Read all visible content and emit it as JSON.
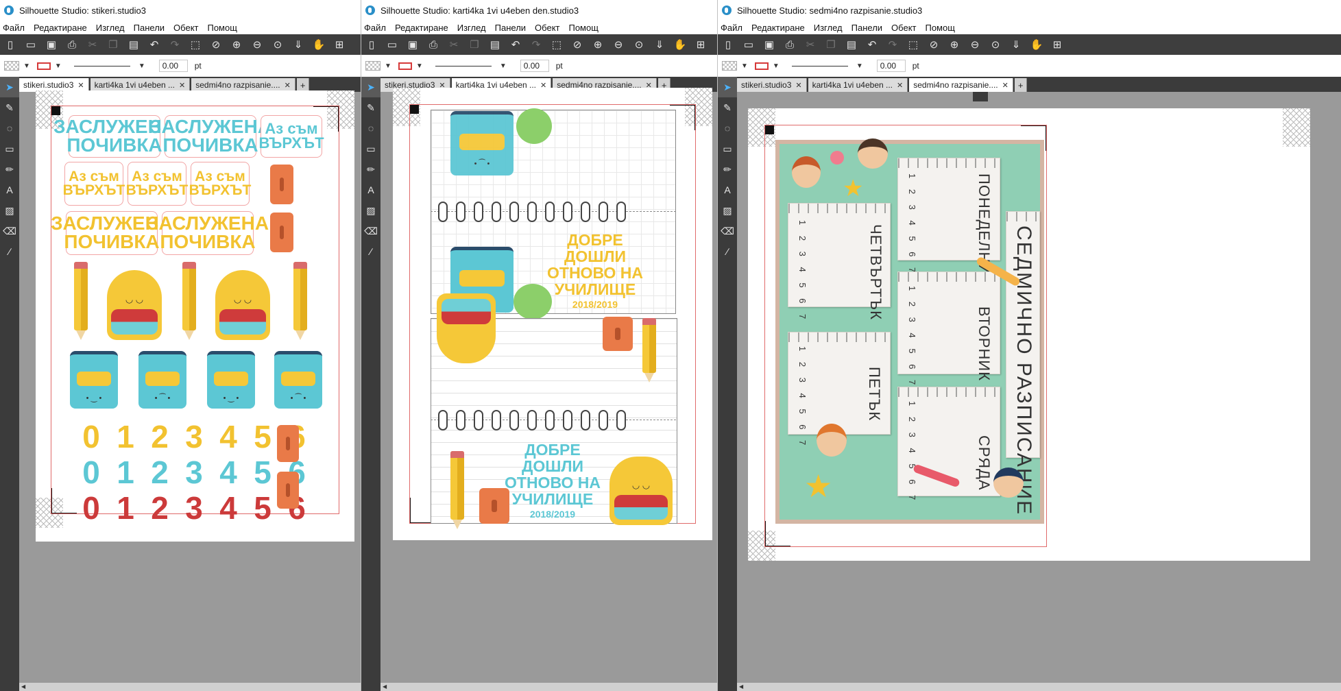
{
  "menu": [
    "Файл",
    "Редактиране",
    "Изглед",
    "Панели",
    "Обект",
    "Помощ"
  ],
  "stroke_width": "0.00",
  "stroke_unit": "pt",
  "tabs": [
    "stikeri.studio3",
    "karti4ka 1vi u4eben ...",
    "sedmi4no razpisanie...."
  ],
  "windows": [
    {
      "title": "Silhouette Studio: stikeri.studio3",
      "active_tab": 0
    },
    {
      "title": "Silhouette Studio: karti4ka 1vi u4eben den.studio3",
      "active_tab": 1
    },
    {
      "title": "Silhouette Studio: sedmi4no razpisanie.studio3",
      "active_tab": 2
    }
  ],
  "stickers": {
    "zasluzhena": "ЗАСЛУЖЕНА ПОЧИВКА",
    "az_sam": "Аз съм ВЪРХЪТ",
    "digits": [
      "0",
      "1",
      "2",
      "3",
      "4",
      "5",
      "6"
    ]
  },
  "card": {
    "welcome_line1": "ДОБРЕ ДОШЛИ",
    "welcome_line2": "ОТНОВО НА",
    "welcome_line3": "УЧИЛИЩЕ",
    "year": "2018/2019"
  },
  "schedule": {
    "title": "СЕДМИЧНО РАЗПИСАНИЕ",
    "days": [
      "ПОНЕДЕЛНИК",
      "ВТОРНИК",
      "СРЯДА",
      "ЧЕТВЪРТЪК",
      "ПЕТЪК"
    ],
    "lesson_numbers": "1 2 3 4 5 6 7"
  },
  "colors": {
    "toolbar": "#3e3e3e",
    "cyan": "#5cc7d4",
    "yellow": "#f2c230",
    "red": "#cc3a3a",
    "mint": "#8fcfb4"
  }
}
